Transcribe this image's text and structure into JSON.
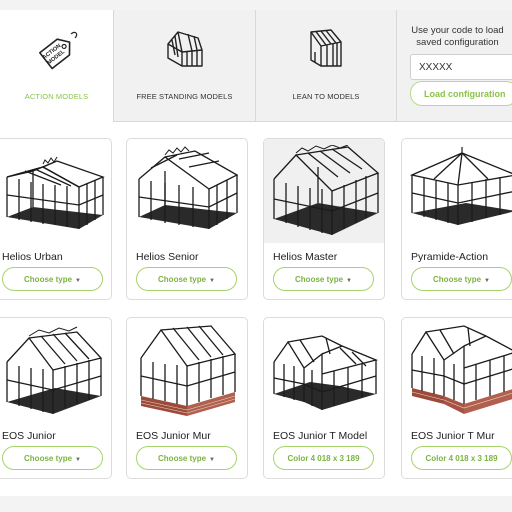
{
  "categories": [
    {
      "label": "ACTION MODELS",
      "icon": "action-model-tag-icon",
      "tag_text": [
        "ACTION",
        "MODEL"
      ],
      "active": true
    },
    {
      "label": "FREE STANDING MODELS",
      "icon": "free-standing-greenhouse-icon",
      "active": false
    },
    {
      "label": "LEAN TO MODELS",
      "icon": "lean-to-greenhouse-icon",
      "active": false
    }
  ],
  "load_config": {
    "prompt": "Use your code to load saved configuration",
    "input_value": "XXXXX",
    "button_label": "Load configuration"
  },
  "products": [
    {
      "title": "Helios Urban",
      "button": "Choose type",
      "caret": true,
      "image": "greenhouse-image"
    },
    {
      "title": "Helios Senior",
      "button": "Choose type",
      "caret": true,
      "image": "greenhouse-image"
    },
    {
      "title": "Helios Master",
      "button": "Choose type",
      "caret": true,
      "image": "greenhouse-image"
    },
    {
      "title": "Pyramide-Action",
      "button": "Choose type",
      "caret": true,
      "image": "greenhouse-image"
    },
    {
      "title": "EOS Junior",
      "button": "Choose type",
      "caret": true,
      "image": "greenhouse-image"
    },
    {
      "title": "EOS Junior Mur",
      "button": "Choose type",
      "caret": true,
      "image": "greenhouse-image"
    },
    {
      "title": "EOS Junior T Model",
      "button": "Color 4 018 x 3 189",
      "caret": false,
      "image": "greenhouse-image"
    },
    {
      "title": "EOS Junior T Mur",
      "button": "Color 4 018 x 3 189",
      "caret": false,
      "image": "greenhouse-image"
    }
  ],
  "colors": {
    "accent": "#8bc34a",
    "accent_border": "#a6d36c",
    "frame": "#1b1b1b",
    "brick": "#9c4a3a"
  }
}
